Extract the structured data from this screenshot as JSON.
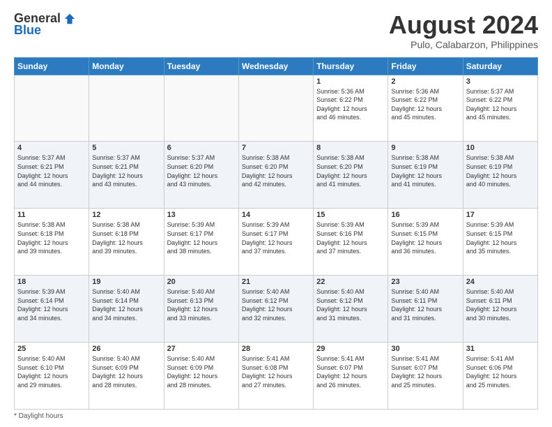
{
  "header": {
    "logo_general": "General",
    "logo_blue": "Blue",
    "month_title": "August 2024",
    "location": "Pulo, Calabarzon, Philippines"
  },
  "days_of_week": [
    "Sunday",
    "Monday",
    "Tuesday",
    "Wednesday",
    "Thursday",
    "Friday",
    "Saturday"
  ],
  "weeks": [
    [
      {
        "day": "",
        "info": ""
      },
      {
        "day": "",
        "info": ""
      },
      {
        "day": "",
        "info": ""
      },
      {
        "day": "",
        "info": ""
      },
      {
        "day": "1",
        "info": "Sunrise: 5:36 AM\nSunset: 6:22 PM\nDaylight: 12 hours\nand 46 minutes."
      },
      {
        "day": "2",
        "info": "Sunrise: 5:36 AM\nSunset: 6:22 PM\nDaylight: 12 hours\nand 45 minutes."
      },
      {
        "day": "3",
        "info": "Sunrise: 5:37 AM\nSunset: 6:22 PM\nDaylight: 12 hours\nand 45 minutes."
      }
    ],
    [
      {
        "day": "4",
        "info": "Sunrise: 5:37 AM\nSunset: 6:21 PM\nDaylight: 12 hours\nand 44 minutes."
      },
      {
        "day": "5",
        "info": "Sunrise: 5:37 AM\nSunset: 6:21 PM\nDaylight: 12 hours\nand 43 minutes."
      },
      {
        "day": "6",
        "info": "Sunrise: 5:37 AM\nSunset: 6:20 PM\nDaylight: 12 hours\nand 43 minutes."
      },
      {
        "day": "7",
        "info": "Sunrise: 5:38 AM\nSunset: 6:20 PM\nDaylight: 12 hours\nand 42 minutes."
      },
      {
        "day": "8",
        "info": "Sunrise: 5:38 AM\nSunset: 6:20 PM\nDaylight: 12 hours\nand 41 minutes."
      },
      {
        "day": "9",
        "info": "Sunrise: 5:38 AM\nSunset: 6:19 PM\nDaylight: 12 hours\nand 41 minutes."
      },
      {
        "day": "10",
        "info": "Sunrise: 5:38 AM\nSunset: 6:19 PM\nDaylight: 12 hours\nand 40 minutes."
      }
    ],
    [
      {
        "day": "11",
        "info": "Sunrise: 5:38 AM\nSunset: 6:18 PM\nDaylight: 12 hours\nand 39 minutes."
      },
      {
        "day": "12",
        "info": "Sunrise: 5:38 AM\nSunset: 6:18 PM\nDaylight: 12 hours\nand 39 minutes."
      },
      {
        "day": "13",
        "info": "Sunrise: 5:39 AM\nSunset: 6:17 PM\nDaylight: 12 hours\nand 38 minutes."
      },
      {
        "day": "14",
        "info": "Sunrise: 5:39 AM\nSunset: 6:17 PM\nDaylight: 12 hours\nand 37 minutes."
      },
      {
        "day": "15",
        "info": "Sunrise: 5:39 AM\nSunset: 6:16 PM\nDaylight: 12 hours\nand 37 minutes."
      },
      {
        "day": "16",
        "info": "Sunrise: 5:39 AM\nSunset: 6:15 PM\nDaylight: 12 hours\nand 36 minutes."
      },
      {
        "day": "17",
        "info": "Sunrise: 5:39 AM\nSunset: 6:15 PM\nDaylight: 12 hours\nand 35 minutes."
      }
    ],
    [
      {
        "day": "18",
        "info": "Sunrise: 5:39 AM\nSunset: 6:14 PM\nDaylight: 12 hours\nand 34 minutes."
      },
      {
        "day": "19",
        "info": "Sunrise: 5:40 AM\nSunset: 6:14 PM\nDaylight: 12 hours\nand 34 minutes."
      },
      {
        "day": "20",
        "info": "Sunrise: 5:40 AM\nSunset: 6:13 PM\nDaylight: 12 hours\nand 33 minutes."
      },
      {
        "day": "21",
        "info": "Sunrise: 5:40 AM\nSunset: 6:12 PM\nDaylight: 12 hours\nand 32 minutes."
      },
      {
        "day": "22",
        "info": "Sunrise: 5:40 AM\nSunset: 6:12 PM\nDaylight: 12 hours\nand 31 minutes."
      },
      {
        "day": "23",
        "info": "Sunrise: 5:40 AM\nSunset: 6:11 PM\nDaylight: 12 hours\nand 31 minutes."
      },
      {
        "day": "24",
        "info": "Sunrise: 5:40 AM\nSunset: 6:11 PM\nDaylight: 12 hours\nand 30 minutes."
      }
    ],
    [
      {
        "day": "25",
        "info": "Sunrise: 5:40 AM\nSunset: 6:10 PM\nDaylight: 12 hours\nand 29 minutes."
      },
      {
        "day": "26",
        "info": "Sunrise: 5:40 AM\nSunset: 6:09 PM\nDaylight: 12 hours\nand 28 minutes."
      },
      {
        "day": "27",
        "info": "Sunrise: 5:40 AM\nSunset: 6:09 PM\nDaylight: 12 hours\nand 28 minutes."
      },
      {
        "day": "28",
        "info": "Sunrise: 5:41 AM\nSunset: 6:08 PM\nDaylight: 12 hours\nand 27 minutes."
      },
      {
        "day": "29",
        "info": "Sunrise: 5:41 AM\nSunset: 6:07 PM\nDaylight: 12 hours\nand 26 minutes."
      },
      {
        "day": "30",
        "info": "Sunrise: 5:41 AM\nSunset: 6:07 PM\nDaylight: 12 hours\nand 25 minutes."
      },
      {
        "day": "31",
        "info": "Sunrise: 5:41 AM\nSunset: 6:06 PM\nDaylight: 12 hours\nand 25 minutes."
      }
    ]
  ],
  "footer": {
    "note": "Daylight hours"
  }
}
